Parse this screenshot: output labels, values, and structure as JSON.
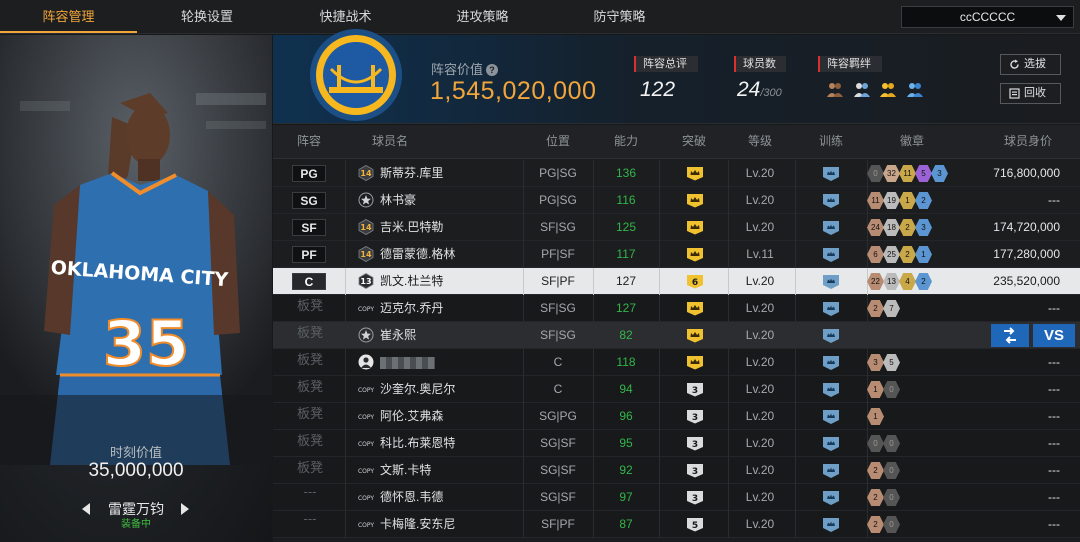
{
  "nav": {
    "tabs": [
      "阵容管理",
      "轮换设置",
      "快捷战术",
      "进攻策略",
      "防守策略"
    ],
    "active_tab": 0,
    "account": "ccCCCCC"
  },
  "left_panel": {
    "jersey_team": "OKLAHOMA CITY",
    "jersey_number": "35",
    "moment_label": "时刻价值",
    "moment_value": "35,000,000",
    "card_name": "雷霆万钧",
    "equip_status": "装备中"
  },
  "header": {
    "team_value_label": "阵容价值",
    "team_value": "1,545,020,000",
    "overall_label": "阵容总评",
    "overall_value": "122",
    "players_label": "球员数",
    "players_value": "24",
    "players_max": "/300",
    "bond_label": "阵容羁绊",
    "select_button": "选拔",
    "recycle_button": "回收"
  },
  "table": {
    "columns": [
      "阵容",
      "球员名",
      "位置",
      "能力",
      "突破",
      "等级",
      "训练",
      "徽章",
      "球员身价"
    ],
    "rows": [
      {
        "slot": "PG",
        "type": "starter",
        "icon": "14",
        "name": "斯蒂芬.库里",
        "pos": "PG|SG",
        "ability": "136",
        "break": "crown",
        "level": "Lv.20",
        "badges": [
          [
            "0",
            "#555"
          ],
          [
            "32",
            "#c9a58c"
          ],
          [
            "11",
            "#c9a84a"
          ],
          [
            "5",
            "#9b63d6"
          ],
          [
            "3",
            "#5b96d2"
          ]
        ],
        "worth": "716,800,000"
      },
      {
        "slot": "SG",
        "type": "starter",
        "icon": "star",
        "name": "林书豪",
        "pos": "PG|SG",
        "ability": "116",
        "break": "crown",
        "level": "Lv.20",
        "badges": [
          [
            "11",
            "#b88c72"
          ],
          [
            "19",
            "#bbbbbb"
          ],
          [
            "1",
            "#c9a84a"
          ],
          [
            "2",
            "#5b96d2"
          ]
        ],
        "worth": "---"
      },
      {
        "slot": "SF",
        "type": "starter",
        "icon": "14",
        "name": "吉米.巴特勒",
        "pos": "SF|SG",
        "ability": "125",
        "break": "crown",
        "level": "Lv.20",
        "badges": [
          [
            "24",
            "#b88c72"
          ],
          [
            "18",
            "#bbbbbb"
          ],
          [
            "2",
            "#c9a84a"
          ],
          [
            "3",
            "#5b96d2"
          ]
        ],
        "worth": "174,720,000"
      },
      {
        "slot": "PF",
        "type": "starter",
        "icon": "14",
        "name": "德雷蒙德.格林",
        "pos": "PF|SF",
        "ability": "117",
        "break": "crown",
        "level": "Lv.11",
        "badges": [
          [
            "6",
            "#b88c72"
          ],
          [
            "25",
            "#bbbbbb"
          ],
          [
            "2",
            "#c9a84a"
          ],
          [
            "1",
            "#5b96d2"
          ]
        ],
        "worth": "177,280,000"
      },
      {
        "slot": "C",
        "type": "selected",
        "icon": "13",
        "name": "凯文.杜兰特",
        "pos": "SF|PF",
        "ability": "127",
        "break": "6",
        "level": "Lv.20",
        "badges": [
          [
            "22",
            "#b88c72"
          ],
          [
            "13",
            "#bbbbbb"
          ],
          [
            "4",
            "#c9a84a"
          ],
          [
            "2",
            "#5b96d2"
          ]
        ],
        "worth": "235,520,000"
      },
      {
        "slot": "板凳",
        "type": "bench",
        "icon": "copy",
        "name": "迈克尔.乔丹",
        "pos": "SF|SG",
        "ability": "127",
        "break": "crown",
        "level": "Lv.20",
        "badges": [
          [
            "2",
            "#b88c72"
          ],
          [
            "7",
            "#bbbbbb"
          ]
        ],
        "worth": "---"
      },
      {
        "slot": "板凳",
        "type": "hover",
        "icon": "star",
        "name": "崔永熙",
        "pos": "SF|SG",
        "ability": "82",
        "break": "crown",
        "level": "Lv.20",
        "badges": [],
        "worth": ""
      },
      {
        "slot": "板凳",
        "type": "bench",
        "icon": "person",
        "name": "",
        "pos": "C",
        "ability": "118",
        "break": "crown",
        "level": "Lv.20",
        "badges": [
          [
            "3",
            "#b88c72"
          ],
          [
            "5",
            "#bbbbbb"
          ]
        ],
        "worth": "---"
      },
      {
        "slot": "板凳",
        "type": "bench",
        "icon": "copy",
        "name": "沙奎尔.奥尼尔",
        "pos": "C",
        "ability": "94",
        "break": "3",
        "level": "Lv.20",
        "badges": [
          [
            "1",
            "#b88c72"
          ],
          [
            "0",
            "#555"
          ]
        ],
        "worth": "---"
      },
      {
        "slot": "板凳",
        "type": "bench",
        "icon": "copy",
        "name": "阿伦.艾弗森",
        "pos": "SG|PG",
        "ability": "96",
        "break": "3",
        "level": "Lv.20",
        "badges": [
          [
            "1",
            "#b88c72"
          ]
        ],
        "worth": "---"
      },
      {
        "slot": "板凳",
        "type": "bench",
        "icon": "copy",
        "name": "科比.布莱恩特",
        "pos": "SG|SF",
        "ability": "95",
        "break": "3",
        "level": "Lv.20",
        "badges": [
          [
            "0",
            "#555"
          ],
          [
            "0",
            "#555"
          ]
        ],
        "worth": "---"
      },
      {
        "slot": "板凳",
        "type": "bench",
        "icon": "copy",
        "name": "文斯.卡特",
        "pos": "SG|SF",
        "ability": "92",
        "break": "3",
        "level": "Lv.20",
        "badges": [
          [
            "2",
            "#b88c72"
          ],
          [
            "0",
            "#555"
          ]
        ],
        "worth": "---"
      },
      {
        "slot": "---",
        "type": "bench",
        "icon": "copy",
        "name": "德怀恩.韦德",
        "pos": "SG|SF",
        "ability": "97",
        "break": "3",
        "level": "Lv.20",
        "badges": [
          [
            "2",
            "#b88c72"
          ],
          [
            "0",
            "#555"
          ]
        ],
        "worth": "---"
      },
      {
        "slot": "---",
        "type": "bench",
        "icon": "copy",
        "name": "卡梅隆.安东尼",
        "pos": "SF|PF",
        "ability": "87",
        "break": "5",
        "level": "Lv.20",
        "badges": [
          [
            "2",
            "#b88c72"
          ],
          [
            "0",
            "#555"
          ]
        ],
        "worth": "---"
      }
    ],
    "row_buttons": {
      "vs": "VS"
    }
  },
  "colors": {
    "accent": "#f2a53a",
    "ability_green": "#33b54a",
    "blue_button": "#1f67b8"
  }
}
